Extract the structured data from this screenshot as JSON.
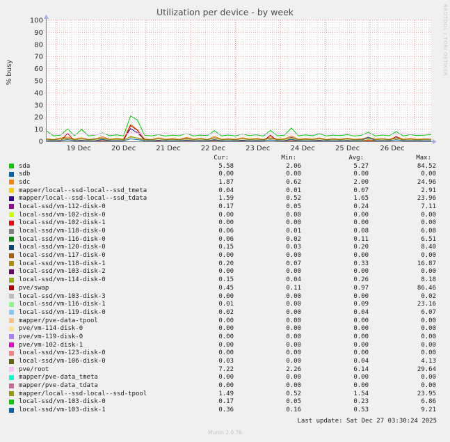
{
  "header": {
    "title": "Utilization per device - by week"
  },
  "watermark": "RRDTOOL / TOBI OETIKER",
  "footer": {
    "last_update": "Last update: Sat Dec 27 03:30:24 2025",
    "version": "Munin 2.0.76"
  },
  "chart_data": {
    "type": "line",
    "title": "Utilization per device - by week",
    "xlabel": "",
    "ylabel": "% busy",
    "ylim": [
      0,
      100
    ],
    "y_tick_step": 10,
    "grid": true,
    "grid_major_color": "#E89191",
    "grid_minor_color": "#D8D8D8",
    "axis_color": "#8a8a8a",
    "axis_arrow_color": "#ABABE0",
    "plot_background": "#FFFFFF",
    "x_tick_labels": [
      "19 Dec",
      "20 Dec",
      "21 Dec",
      "22 Dec",
      "23 Dec",
      "24 Dec",
      "25 Dec",
      "26 Dec"
    ],
    "series": [
      {
        "name": "sdc",
        "color": "#FF8000",
        "values": [
          2.1,
          1.5,
          2.8,
          3.5,
          1.8,
          3.0,
          1.6,
          2.2,
          3.8,
          1.7,
          2.4,
          1.9,
          14.0,
          9.5,
          2.0,
          1.6,
          2.9,
          1.8,
          2.3,
          1.7,
          3.2,
          1.9,
          2.5,
          1.6,
          4.0,
          1.8,
          2.2,
          1.7,
          3.0,
          1.9,
          2.4,
          1.6,
          3.6,
          1.8,
          2.1,
          4.5,
          1.7,
          2.3,
          1.9,
          2.8,
          1.6,
          2.2,
          1.8,
          2.6,
          1.7,
          2.0,
          3.4,
          1.9,
          2.3,
          1.6,
          3.8,
          1.8,
          2.4,
          1.7,
          2.1,
          1.9
        ]
      },
      {
        "name": "mapper/local--ssd-local--ssd_tdata",
        "color": "#330099",
        "values": [
          1.6,
          1.2,
          2.0,
          2.6,
          1.3,
          2.2,
          1.2,
          1.7,
          2.8,
          1.3,
          1.8,
          1.4,
          10.5,
          7.0,
          1.5,
          1.2,
          2.1,
          1.3,
          1.7,
          1.2,
          2.4,
          1.4,
          1.9,
          1.2,
          3.0,
          1.3,
          1.7,
          1.2,
          2.2,
          1.4,
          1.8,
          1.2,
          2.7,
          1.3,
          1.6,
          3.4,
          1.2,
          1.7,
          1.4,
          2.1,
          1.2,
          1.7,
          1.3,
          2.0,
          1.2,
          1.5,
          2.6,
          1.4,
          1.8,
          1.2,
          2.9,
          1.3,
          1.8,
          1.2,
          1.6,
          1.6
        ]
      },
      {
        "name": "pve/swap",
        "color": "#B30000",
        "values": [
          0.4,
          0.3,
          0.3,
          6.5,
          0.3,
          0.4,
          0.3,
          0.3,
          0.5,
          0.3,
          0.4,
          0.3,
          13.0,
          9.0,
          0.4,
          0.3,
          0.3,
          0.4,
          0.3,
          0.3,
          0.5,
          0.3,
          0.4,
          0.3,
          0.6,
          0.3,
          0.4,
          0.3,
          0.3,
          0.4,
          0.3,
          0.3,
          5.0,
          0.4,
          0.3,
          0.5,
          0.3,
          0.4,
          0.3,
          0.3,
          0.5,
          0.3,
          0.4,
          0.3,
          0.3,
          0.4,
          0.5,
          0.3,
          0.4,
          0.3,
          4.0,
          0.3,
          0.4,
          0.3,
          0.3,
          0.5
        ]
      },
      {
        "name": "local-ssd/vm-118-disk-1",
        "color": "#B38F00",
        "values": [
          0.5,
          0.3,
          0.8,
          1.5,
          0.4,
          1.0,
          0.3,
          0.6,
          1.8,
          0.4,
          0.7,
          0.5,
          4.0,
          2.5,
          0.5,
          0.3,
          0.9,
          0.4,
          0.6,
          0.3,
          1.2,
          0.5,
          0.8,
          0.3,
          1.6,
          0.4,
          0.6,
          0.3,
          1.0,
          0.5,
          0.7,
          0.3,
          1.4,
          0.4,
          0.6,
          2.0,
          0.3,
          0.6,
          0.5,
          0.9,
          0.3,
          0.6,
          0.4,
          0.8,
          0.3,
          0.5,
          1.3,
          0.5,
          0.7,
          0.3,
          1.5,
          0.4,
          0.7,
          0.3,
          0.5,
          0.4
        ]
      },
      {
        "name": "mapper/local--ssd-local--ssd-tpool",
        "color": "#999900",
        "values": [
          1.5,
          1.1,
          1.9,
          2.4,
          1.2,
          2.0,
          1.1,
          1.6,
          2.6,
          1.2,
          1.7,
          1.3,
          3.5,
          2.8,
          1.4,
          1.1,
          2.0,
          1.2,
          1.6,
          1.1,
          2.2,
          1.3,
          1.8,
          1.1,
          2.8,
          1.2,
          1.6,
          1.1,
          2.1,
          1.3,
          1.7,
          1.1,
          2.5,
          1.2,
          1.5,
          3.1,
          1.1,
          1.6,
          1.3,
          2.0,
          1.1,
          1.6,
          1.2,
          1.9,
          1.1,
          1.4,
          2.4,
          1.3,
          1.7,
          1.1,
          2.7,
          1.2,
          1.7,
          1.1,
          1.5,
          1.5
        ]
      },
      {
        "name": "local-ssd/vm-103-disk-1",
        "color": "#0066B3",
        "values": [
          0.5,
          0.4,
          0.6,
          1.2,
          0.4,
          0.7,
          0.4,
          0.5,
          1.5,
          0.4,
          0.6,
          0.4,
          2.0,
          1.4,
          0.5,
          0.4,
          0.7,
          0.4,
          0.5,
          0.4,
          0.9,
          0.4,
          0.6,
          0.4,
          1.3,
          0.4,
          0.5,
          0.4,
          0.8,
          0.4,
          0.6,
          0.4,
          1.1,
          0.4,
          0.5,
          1.6,
          0.4,
          0.5,
          0.4,
          0.7,
          0.4,
          0.5,
          0.4,
          0.6,
          0.4,
          0.5,
          3.5,
          0.4,
          0.6,
          0.4,
          1.2,
          0.4,
          0.6,
          0.4,
          0.5,
          0.4
        ]
      },
      {
        "name": "sda",
        "color": "#00CC00",
        "values": [
          8.5,
          4.5,
          5.0,
          10.2,
          4.6,
          9.8,
          4.4,
          5.2,
          7.0,
          4.6,
          5.3,
          4.4,
          21.0,
          17.5,
          5.0,
          4.5,
          5.5,
          4.3,
          5.0,
          4.6,
          6.5,
          4.4,
          5.1,
          4.7,
          8.8,
          4.5,
          5.2,
          4.4,
          6.0,
          4.7,
          5.4,
          4.3,
          9.0,
          4.6,
          5.0,
          11.0,
          4.5,
          5.3,
          4.6,
          6.2,
          4.4,
          5.1,
          4.7,
          5.6,
          4.3,
          5.0,
          7.5,
          4.5,
          5.2,
          4.6,
          8.0,
          4.4,
          5.5,
          4.7,
          5.0,
          5.6
        ]
      },
      {
        "name": "pve/root",
        "color": "#FFBFFF",
        "values": [
          5.8,
          6.2,
          5.5,
          6.8,
          5.6,
          6.4,
          5.9,
          5.4,
          6.6,
          5.7,
          6.1,
          5.5,
          7.2,
          6.8,
          5.8,
          6.3,
          5.6,
          6.7,
          5.9,
          5.5,
          6.4,
          5.8,
          6.2,
          5.6,
          6.9,
          5.7,
          6.3,
          5.9,
          5.5,
          6.6,
          5.8,
          6.1,
          5.6,
          7.0,
          5.9,
          6.4,
          5.7,
          6.2,
          5.5,
          6.8,
          5.8,
          6.3,
          5.6,
          6.5,
          5.9,
          6.1,
          5.7,
          6.6,
          5.8,
          6.2,
          5.6,
          6.9,
          5.7,
          6.3,
          5.9,
          7.2
        ]
      }
    ],
    "legend": {
      "columns": [
        "Cur:",
        "Min:",
        "Avg:",
        "Max:"
      ],
      "rows": [
        {
          "name": "sda",
          "color": "#00CC00",
          "cur": "5.58",
          "min": "2.06",
          "avg": "5.27",
          "max": "84.52"
        },
        {
          "name": "sdb",
          "color": "#0066B3",
          "cur": "0.00",
          "min": "0.00",
          "avg": "0.00",
          "max": "0.00"
        },
        {
          "name": "sdc",
          "color": "#FF8000",
          "cur": "1.87",
          "min": "0.62",
          "avg": "2.00",
          "max": "24.96"
        },
        {
          "name": "mapper/local--ssd-local--ssd_tmeta",
          "color": "#FFCC00",
          "cur": "0.04",
          "min": "0.01",
          "avg": "0.07",
          "max": "2.91"
        },
        {
          "name": "mapper/local--ssd-local--ssd_tdata",
          "color": "#330099",
          "cur": "1.59",
          "min": "0.52",
          "avg": "1.65",
          "max": "23.96"
        },
        {
          "name": "local-ssd/vm-112-disk-0",
          "color": "#990099",
          "cur": "0.17",
          "min": "0.05",
          "avg": "0.24",
          "max": "7.11"
        },
        {
          "name": "local-ssd/vm-102-disk-0",
          "color": "#CCFF00",
          "cur": "0.00",
          "min": "0.00",
          "avg": "0.00",
          "max": "0.00"
        },
        {
          "name": "local-ssd/vm-102-disk-1",
          "color": "#FF0000",
          "cur": "0.00",
          "min": "0.00",
          "avg": "0.00",
          "max": "0.00"
        },
        {
          "name": "local-ssd/vm-118-disk-0",
          "color": "#808080",
          "cur": "0.06",
          "min": "0.01",
          "avg": "0.08",
          "max": "6.08"
        },
        {
          "name": "local-ssd/vm-116-disk-0",
          "color": "#008F00",
          "cur": "0.06",
          "min": "0.02",
          "avg": "0.11",
          "max": "6.51"
        },
        {
          "name": "local-ssd/vm-120-disk-0",
          "color": "#00487D",
          "cur": "0.15",
          "min": "0.03",
          "avg": "0.20",
          "max": "8.40"
        },
        {
          "name": "local-ssd/vm-117-disk-0",
          "color": "#B35A00",
          "cur": "0.00",
          "min": "0.00",
          "avg": "0.00",
          "max": "0.00"
        },
        {
          "name": "local-ssd/vm-118-disk-1",
          "color": "#B38F00",
          "cur": "0.20",
          "min": "0.07",
          "avg": "0.33",
          "max": "16.87"
        },
        {
          "name": "local-ssd/vm-103-disk-2",
          "color": "#6B006B",
          "cur": "0.00",
          "min": "0.00",
          "avg": "0.00",
          "max": "0.00"
        },
        {
          "name": "local-ssd/vm-114-disk-0",
          "color": "#8FB300",
          "cur": "0.15",
          "min": "0.04",
          "avg": "0.26",
          "max": "8.18"
        },
        {
          "name": "pve/swap",
          "color": "#B30000",
          "cur": "0.45",
          "min": "0.11",
          "avg": "0.97",
          "max": "86.46"
        },
        {
          "name": "local-ssd/vm-103-disk-3",
          "color": "#BEBEBE",
          "cur": "0.00",
          "min": "0.00",
          "avg": "0.00",
          "max": "0.02"
        },
        {
          "name": "local-ssd/vm-116-disk-1",
          "color": "#80FF80",
          "cur": "0.01",
          "min": "0.00",
          "avg": "0.09",
          "max": "23.16"
        },
        {
          "name": "local-ssd/vm-119-disk-0",
          "color": "#80C9FF",
          "cur": "0.02",
          "min": "0.00",
          "avg": "0.04",
          "max": "6.07"
        },
        {
          "name": "mapper/pve-data-tpool",
          "color": "#FFC080",
          "cur": "0.00",
          "min": "0.00",
          "avg": "0.00",
          "max": "0.00"
        },
        {
          "name": "pve/vm-114-disk-0",
          "color": "#FFE680",
          "cur": "0.00",
          "min": "0.00",
          "avg": "0.00",
          "max": "0.00"
        },
        {
          "name": "pve/vm-119-disk-0",
          "color": "#AA80FF",
          "cur": "0.00",
          "min": "0.00",
          "avg": "0.00",
          "max": "0.00"
        },
        {
          "name": "pve/vm-102-disk-1",
          "color": "#EE00CC",
          "cur": "0.00",
          "min": "0.00",
          "avg": "0.00",
          "max": "0.00"
        },
        {
          "name": "local-ssd/vm-123-disk-0",
          "color": "#FF8080",
          "cur": "0.00",
          "min": "0.00",
          "avg": "0.00",
          "max": "0.00"
        },
        {
          "name": "local-ssd/vm-106-disk-0",
          "color": "#666600",
          "cur": "0.03",
          "min": "0.00",
          "avg": "0.04",
          "max": "4.13"
        },
        {
          "name": "pve/root",
          "color": "#FFBFFF",
          "cur": "7.22",
          "min": "2.26",
          "avg": "6.14",
          "max": "29.64"
        },
        {
          "name": "mapper/pve-data_tmeta",
          "color": "#00FFCC",
          "cur": "0.00",
          "min": "0.00",
          "avg": "0.00",
          "max": "0.00"
        },
        {
          "name": "mapper/pve-data_tdata",
          "color": "#CC6699",
          "cur": "0.00",
          "min": "0.00",
          "avg": "0.00",
          "max": "0.00"
        },
        {
          "name": "mapper/local--ssd-local--ssd-tpool",
          "color": "#999900",
          "cur": "1.49",
          "min": "0.52",
          "avg": "1.54",
          "max": "23.95"
        },
        {
          "name": "local-ssd/vm-103-disk-0",
          "color": "#00CC00",
          "cur": "0.17",
          "min": "0.05",
          "avg": "0.23",
          "max": "6.86"
        },
        {
          "name": "local-ssd/vm-103-disk-1",
          "color": "#0066B3",
          "cur": "0.36",
          "min": "0.16",
          "avg": "0.53",
          "max": "9.21"
        }
      ]
    }
  }
}
